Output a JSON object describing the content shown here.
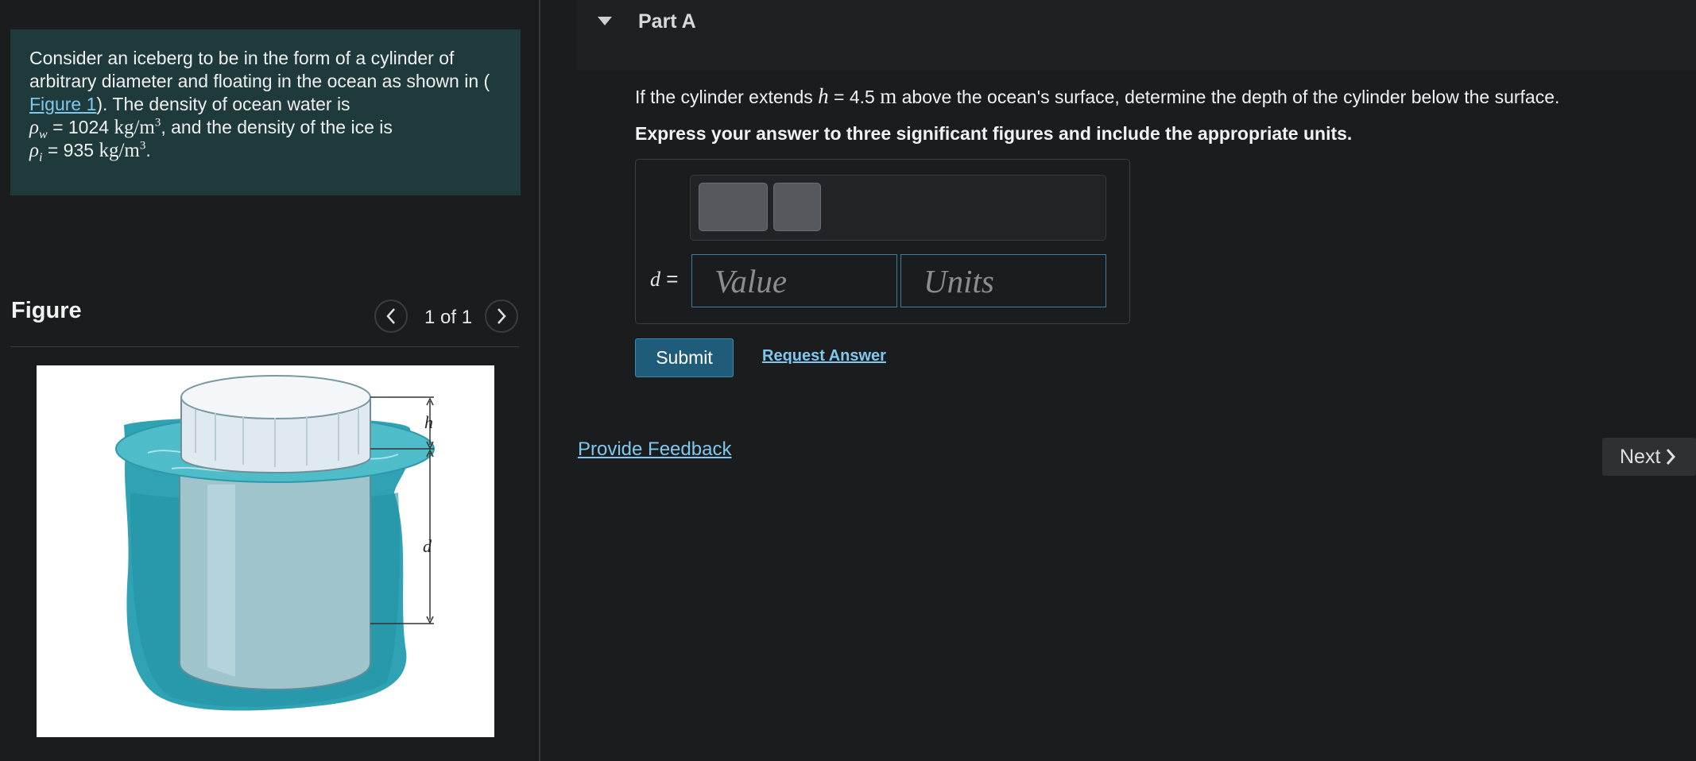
{
  "problem": {
    "line1": "Consider an iceberg to be in the form of a cylinder of",
    "line2_pre": "arbitrary diameter and floating in the ocean as shown in (",
    "figure_link": "Figure 1",
    "line3_post": "). The density of ocean water is",
    "rho_w_symbol": "ρ",
    "rho_w_sub": "w",
    "rho_w_value": "= 1024",
    "rho_w_unit": "kg/m",
    "rho_w_exp": "3",
    "line4_post": ", and the density of the ice is",
    "rho_i_symbol": "ρ",
    "rho_i_sub": "i",
    "rho_i_value": "= 935",
    "rho_i_unit": "kg/m",
    "rho_i_exp": "3",
    "period": "."
  },
  "figure": {
    "title": "Figure",
    "counter": "1 of 1",
    "label_h": "h",
    "label_d": "d",
    "colors": {
      "water": "#2fa3b3",
      "ice": "#dfeaf0",
      "submerged": "#9fc4cc"
    }
  },
  "part": {
    "title": "Part A"
  },
  "question": {
    "pre": "If the cylinder extends ",
    "var": "h",
    "eq": " = 4.5 ",
    "unit": "m",
    "post": " above the ocean's surface, determine the depth of the cylinder below the surface."
  },
  "instruction": "Express your answer to three significant figures and include the appropriate units.",
  "answer": {
    "var": "d",
    "eq": " =",
    "value_placeholder": "Value",
    "units_placeholder": "Units"
  },
  "buttons": {
    "submit": "Submit",
    "request_answer": "Request Answer",
    "provide_feedback": "Provide Feedback",
    "next": "Next"
  },
  "colors": {
    "accent": "#7fc8ef",
    "submit_bg": "#1f5c7a",
    "panel": "#1f3a3a"
  }
}
